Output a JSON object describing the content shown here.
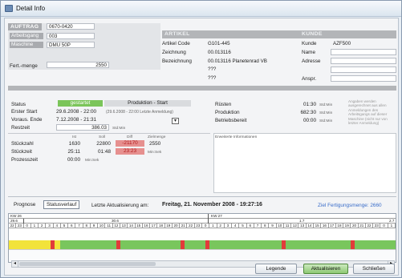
{
  "window": {
    "title": "Detail Info"
  },
  "auftrag": {
    "header": "AUFTRAG",
    "fields": [
      {
        "label": "Auftrag",
        "value": "0670-0420"
      },
      {
        "label": "Arbeitsgang",
        "value": "003"
      },
      {
        "label": "Maschine",
        "value": "DMU 50P"
      }
    ],
    "fert_menge_label": "Fert.-menge",
    "fert_menge_value": "2550"
  },
  "artikel": {
    "header": "ARTIKEL",
    "rows": [
      {
        "label": "Artikel Code",
        "value": "G101-445"
      },
      {
        "label": "Zeichnung",
        "value": "00.013116"
      },
      {
        "label": "Bezeichnung",
        "value": "00.013116 Planetenrad VB"
      },
      {
        "label": "",
        "value": "???"
      },
      {
        "label": "",
        "value": "???"
      }
    ]
  },
  "kunde": {
    "header": "KUNDE",
    "rows": [
      {
        "label": "Kunde",
        "value": "AZF500"
      },
      {
        "label": "Name",
        "value": ""
      },
      {
        "label": "Adresse",
        "value": ""
      },
      {
        "label": "",
        "value": ""
      },
      {
        "label": "Anspr.",
        "value": ""
      }
    ]
  },
  "status": {
    "status_label": "Status",
    "status_value": "gestartet",
    "produktion_label": "Produktion - Start",
    "erster_start_label": "Erster Start",
    "erster_start_value": "29.6.2008 - 22:00",
    "erster_start_hint": "(29.6.2008 - 22:00  Letzte Anmeldung)",
    "voraus_ende_label": "Voraus. Ende",
    "voraus_ende_value": "7.12.2008 - 21:31",
    "restzeit_label": "Restzeit",
    "restzeit_value": "386.03",
    "restzeit_unit": "Std:Min"
  },
  "zeiten": {
    "rows": [
      {
        "label": "Rüsten",
        "value": "01:30",
        "unit": "Std:Min"
      },
      {
        "label": "Produktion",
        "value": "682:30",
        "unit": "Std:Min"
      },
      {
        "label": "Betriebsbereit",
        "value": "00:00",
        "unit": "Std:Min"
      }
    ],
    "note": "Angaben werden ausgerechnet aus allen Anmeldungen des Arbeitsgangs auf dieser Maschine (nicht nur von letzter Anmeldung)"
  },
  "mengen": {
    "col_ist": "Ist",
    "col_soll": "Soll",
    "col_diff": "Diff",
    "col_zielmenge": "Zielmenge",
    "stueckzahl_label": "Stückzahl",
    "stueckzahl_ist": "1630",
    "stueckzahl_soll": "22800",
    "stueckzahl_diff": "-21170",
    "zielmenge_value": "2550",
    "stueckzeit_label": "Stückzeit",
    "stueckzeit_ist": "25:11",
    "stueckzeit_soll": "01:48",
    "stueckzeit_diff": "23:23",
    "stueckzeit_unit": "Min:Sek",
    "prozesszeit_label": "Prozesszeit",
    "prozesszeit_ist": "00:00",
    "prozesszeit_unit": "Min:Sek",
    "erweiterte_label": "Erweiterte Informationen"
  },
  "prognose": {
    "tabs": [
      "Prognose",
      "Statusverlauf"
    ],
    "active_tab": "Statusverlauf",
    "update_prefix": "Letzte Aktualisierung am:",
    "update_value": "Freitag, 21. November 2008 - 19:27:16",
    "ziel_label": "Ziel Fertigungsmenge: 2660"
  },
  "timeline": {
    "week_left": "KW 26",
    "week_mid": "KW 27",
    "day_a": "29.6",
    "day_b": "30.6",
    "day_c": "1.7",
    "day_d": "2.7",
    "hours_a": [
      "22",
      "23",
      "0",
      "1",
      "2",
      "3",
      "4",
      "5",
      "6",
      "7",
      "8",
      "9",
      "10",
      "11",
      "12",
      "13",
      "14",
      "15",
      "16",
      "17",
      "18",
      "19",
      "20",
      "21",
      "22",
      "23"
    ],
    "hours_b": [
      "0",
      "1",
      "2",
      "3",
      "4",
      "5",
      "6",
      "7",
      "8",
      "9",
      "10",
      "11",
      "12",
      "13",
      "14",
      "15",
      "16",
      "17",
      "18",
      "19",
      "20",
      "21",
      "22",
      "23",
      "0",
      "1"
    ],
    "colors": {
      "setup": "#f2e33a",
      "production": "#79c65d",
      "stop": "#e23a3a"
    }
  },
  "buttons": {
    "legende": "Legende",
    "aktualisieren": "Aktualisieren",
    "schliessen": "Schließen"
  }
}
